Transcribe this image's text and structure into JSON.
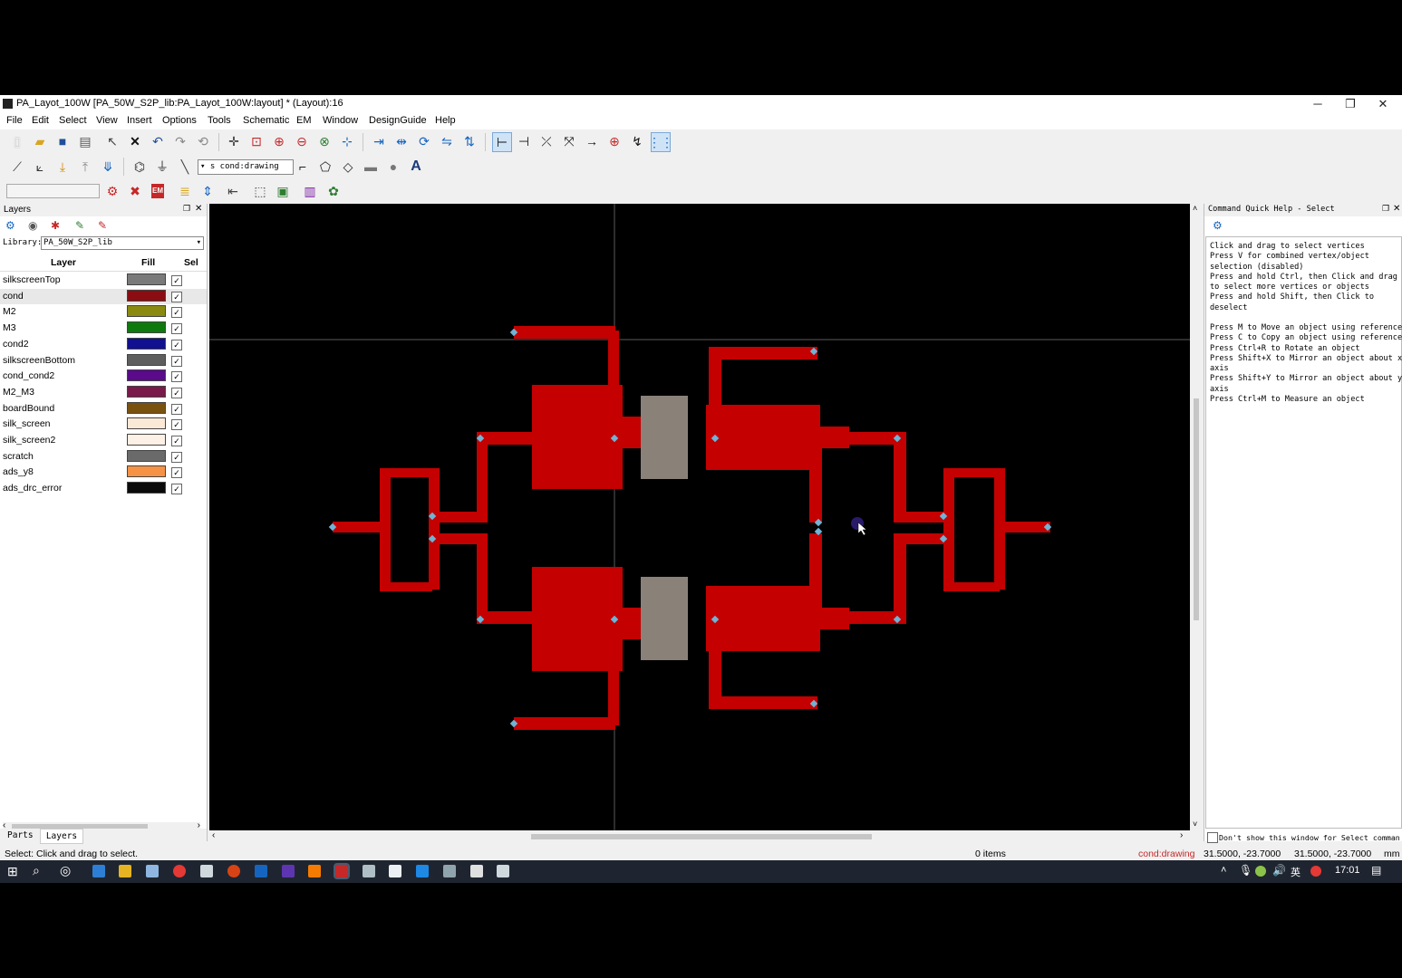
{
  "window": {
    "title": "PA_Layot_100W [PA_50W_S2P_lib:PA_Layot_100W:layout] * (Layout):16",
    "minimize": "─",
    "maximize": "❐",
    "close": "✕"
  },
  "menu": [
    "File",
    "Edit",
    "Select",
    "View",
    "Insert",
    "Options",
    "Tools",
    "Schematic",
    "EM",
    "Window",
    "DesignGuide",
    "Help"
  ],
  "toolbar": {
    "layer_combo": "▾ s cond:drawing",
    "em_label": "EM"
  },
  "layers_panel": {
    "title": "Layers",
    "library_label": "Library:",
    "library_value": "PA_50W_S2P_lib",
    "col_layer": "Layer",
    "col_fill": "Fill",
    "col_sel": "Sel",
    "tab_parts": "Parts",
    "tab_layers": "Layers",
    "rows": [
      {
        "name": "silkscreenTop",
        "color": "#7a7a7a",
        "sel": "✓"
      },
      {
        "name": "cond",
        "color": "#8b0d12",
        "sel": "✓"
      },
      {
        "name": "M2",
        "color": "#8a8a10",
        "sel": "✓"
      },
      {
        "name": "M3",
        "color": "#0e7a0e",
        "sel": "✓"
      },
      {
        "name": "cond2",
        "color": "#101090",
        "sel": "✓"
      },
      {
        "name": "silkscreenBottom",
        "color": "#5e5e5e",
        "sel": "✓"
      },
      {
        "name": "cond_cond2",
        "color": "#5a0a8a",
        "sel": "✓"
      },
      {
        "name": "M2_M3",
        "color": "#7a1a4a",
        "sel": "✓"
      },
      {
        "name": "boardBound",
        "color": "#7a5210",
        "sel": "✓"
      },
      {
        "name": "silk_screen",
        "color": "#fbe9d8",
        "sel": "✓"
      },
      {
        "name": "silk_screen2",
        "color": "#fdf0e4",
        "sel": "✓"
      },
      {
        "name": "scratch",
        "color": "#6a6a6a",
        "sel": "✓"
      },
      {
        "name": "ads_y8",
        "color": "#f59246",
        "sel": "✓"
      },
      {
        "name": "ads_drc_error",
        "color": "#0a0a0a",
        "sel": "✓"
      }
    ]
  },
  "help_panel": {
    "title": "Command Quick Help - Select",
    "lines": [
      "Click and drag to select vertices",
      "Press V for combined vertex/object",
      "selection (disabled)",
      "Press and hold Ctrl, then Click and drag",
      "to select more vertices or objects",
      "Press and hold Shift, then Click to",
      "deselect",
      "",
      "Press M to Move an object using reference",
      "Press C to Copy an object using reference",
      "Press Ctrl+R to Rotate an object",
      "Press Shift+X to Mirror an object about x-",
      "axis",
      "Press Shift+Y to Mirror an object about y-",
      "axis",
      "Press Ctrl+M to Measure an object"
    ],
    "dont_show": "Don't show this window for Select comman"
  },
  "status": {
    "message": "Select: Click and drag to select.",
    "items": "0 items",
    "layer": "cond:drawing",
    "coord1": "31.5000, -23.7000",
    "coord2": "31.5000, -23.7000",
    "unit": "mm"
  },
  "taskbar": {
    "time": "17:01",
    "ime": "英"
  },
  "colors": {
    "trace": "#c40000",
    "component": "#8a8179",
    "pin": "#6fb3d6"
  }
}
